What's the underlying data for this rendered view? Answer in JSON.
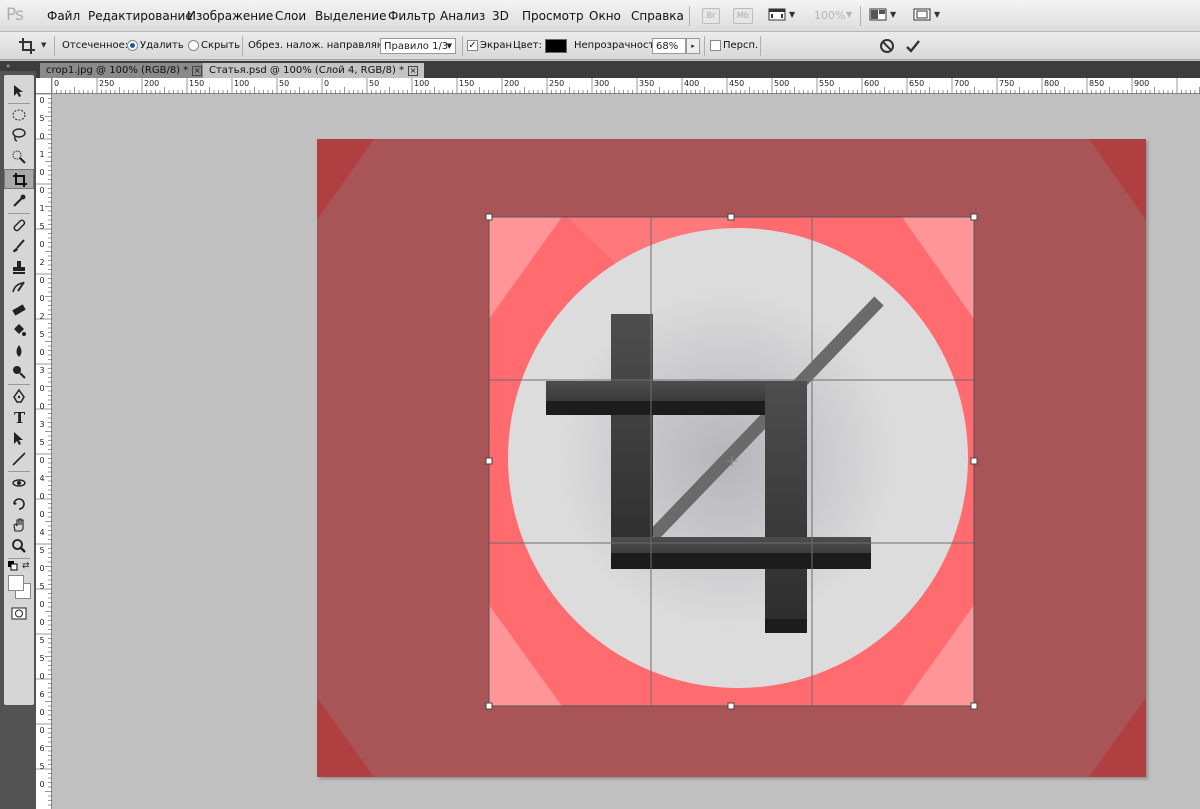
{
  "app": {
    "logo": "Ps"
  },
  "menu": {
    "items": [
      "Файл",
      "Редактирование",
      "Изображение",
      "Слои",
      "Выделение",
      "Фильтр",
      "Анализ",
      "3D",
      "Просмотр",
      "Окно",
      "Справка"
    ],
    "bridge_label": "Br",
    "minibridge_label": "Mb",
    "zoom_level": "100%"
  },
  "options": {
    "cropped_label": "Отсеченное:",
    "delete_label": "Удалить",
    "hide_label": "Скрыть",
    "overlay_label": "Обрез. налож. направляющ.:",
    "overlay_value": "Правило 1/3",
    "shield_label": "Экран",
    "color_label": "Цвет:",
    "color_value": "#000000",
    "opacity_label": "Непрозрачность:",
    "opacity_value": "68%",
    "perspective_label": "Персп.",
    "delete_checked": true,
    "hide_checked": false,
    "shield_checked": true,
    "perspective_checked": false
  },
  "tabs": [
    {
      "label": "crop1.jpg @ 100% (RGB/8) *",
      "active": false
    },
    {
      "label": "Статья.psd @ 100% (Слой 4, RGB/8) *",
      "active": true
    }
  ],
  "rulers": {
    "horizontal": [
      "0",
      "250",
      "200",
      "150",
      "100",
      "50",
      "0",
      "50",
      "100",
      "150",
      "200",
      "250",
      "300",
      "350",
      "400",
      "450",
      "500",
      "550",
      "600",
      "650",
      "700",
      "750",
      "800",
      "850",
      "900"
    ],
    "vertical": [
      "0",
      "5",
      "0",
      "1",
      "0",
      "0",
      "1",
      "5",
      "0",
      "2",
      "0",
      "0",
      "2",
      "5",
      "0",
      "3",
      "0",
      "0",
      "3",
      "5",
      "0",
      "4",
      "0",
      "0",
      "4",
      "5",
      "0",
      "5",
      "0",
      "0",
      "5",
      "5",
      "0",
      "6",
      "0",
      "0",
      "6",
      "5",
      "0"
    ]
  },
  "colors": {
    "canvas_red": "#b03f42",
    "inner_red": "#ff6b6e",
    "circle": "#dcdcdc",
    "crop_icon": "#3c3c3c"
  },
  "tools": [
    "move-tool",
    "marquee-tool",
    "lasso-tool",
    "quick-select-tool",
    "crop-tool",
    "eyedropper-tool",
    "healing-brush-tool",
    "brush-tool",
    "clone-stamp-tool",
    "history-brush-tool",
    "eraser-tool",
    "paint-bucket-tool",
    "blur-tool",
    "dodge-tool",
    "pen-tool",
    "type-tool",
    "path-select-tool",
    "line-tool",
    "3d-rotate-tool",
    "3d-orbit-tool",
    "hand-tool",
    "zoom-tool"
  ]
}
